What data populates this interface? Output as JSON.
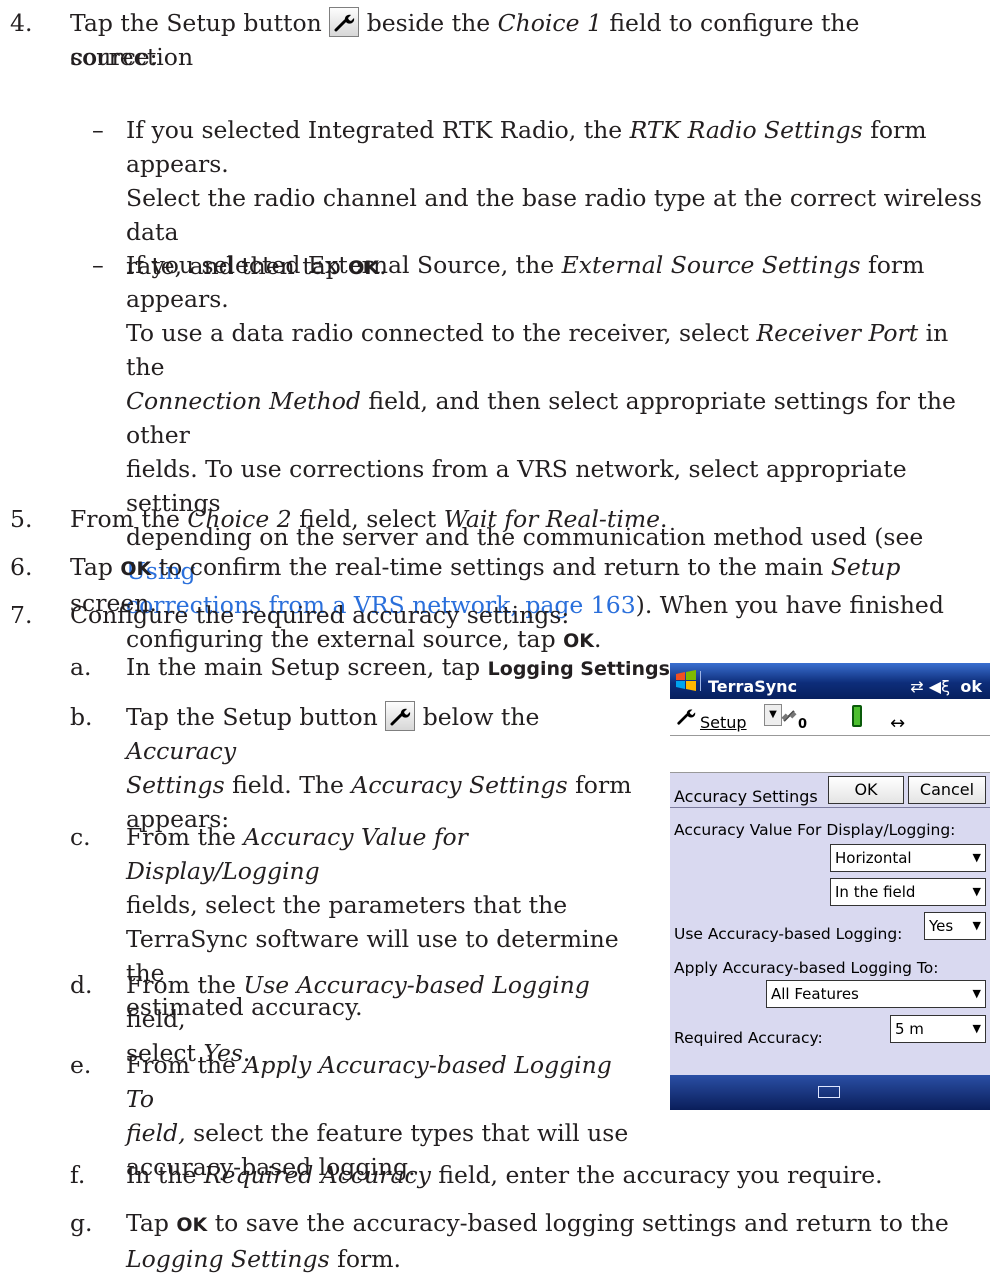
{
  "step4": {
    "num": "4.",
    "t1": "Tap the Setup button ",
    "t2": " beside the ",
    "t3": "Choice 1",
    "t4": " field to configure the correction",
    "t5": "source:"
  },
  "bullet1": {
    "dash": "–",
    "l1a": "If you selected Integrated RTK Radio, the ",
    "l1b": "RTK Radio Settings",
    "l1c": " form appears.",
    "l2": "Select the radio channel and the base radio type at the correct wireless data",
    "l3a": "rate, and then tap ",
    "l3b": "OK",
    "l3c": "."
  },
  "bullet2": {
    "dash": "–",
    "l1a": "If you selected External Source, the ",
    "l1b": "External Source Settings",
    "l1c": " form appears.",
    "l2a": "To use a data radio connected to the receiver, select ",
    "l2b": "Receiver Port",
    "l2c": " in the",
    "l3a": "Connection Method",
    "l3b": " field, and then select appropriate settings for the other",
    "l4": "fields. To use corrections from a VRS network, select appropriate settings",
    "l5a": "depending on the server and the communication method used (see ",
    "l5b": "Using",
    "l6a": "corrections from a VRS network, page 163",
    "l6b": "). When you have finished",
    "l7a": "configuring the external source, tap ",
    "l7b": "OK",
    "l7c": "."
  },
  "step5": {
    "num": "5.",
    "a": "From the ",
    "b": "Choice 2",
    "c": " field, select ",
    "d": "Wait for Real-time",
    "e": "."
  },
  "step6": {
    "num": "6.",
    "a": "Tap ",
    "b": "OK",
    "c": " to confirm the real-time settings and return to the main ",
    "d": "Setup",
    "e": " screen."
  },
  "step7": {
    "num": "7.",
    "a": "Configure the required accuracy settings:"
  },
  "sa": {
    "num": "a.",
    "a": "In the main Setup screen, tap ",
    "b": "Logging Settings",
    "c": "."
  },
  "sb": {
    "num": "b.",
    "l1a": "Tap the Setup button ",
    "l1b": " below the ",
    "l1c": "Accuracy",
    "l2a": "Settings",
    "l2b": " field. The ",
    "l2c": "Accuracy Settings",
    "l2d": " form",
    "l3": "appears:"
  },
  "sc": {
    "num": "c.",
    "l1a": "From the ",
    "l1b": "Accuracy Value for Display/Logging",
    "l2": "fields, select the parameters that the",
    "l3": "TerraSync software will use to determine the",
    "l4": "estimated accuracy."
  },
  "sd": {
    "num": "d.",
    "l1a": "From the ",
    "l1b": "Use Accuracy-based Logging",
    "l1c": " field,",
    "l2a": "select ",
    "l2b": "Yes",
    "l2c": "."
  },
  "se": {
    "num": "e.",
    "l1a": "From the ",
    "l1b": "Apply Accuracy-based Logging To",
    "l2a": "field,",
    "l2b": " select the feature types that will use",
    "l3": "accuracy-based logging."
  },
  "sf": {
    "num": "f.",
    "a": "In the ",
    "b": "Required Accuracy",
    "c": " field, enter the accuracy you require."
  },
  "sg": {
    "num": "g.",
    "l1a": "Tap ",
    "l1b": "OK",
    "l1c": " to save the accuracy-based logging settings and return to the",
    "l2a": "Logging Settings",
    "l2b": " form."
  },
  "device": {
    "app_title": "TerraSync",
    "ok": "ok",
    "tray": "⇄ ◀ξ",
    "setup_label": "Setup",
    "sat_count": "0",
    "arrow": "↔",
    "form_title": "Accuracy Settings",
    "ok_button": "OK",
    "cancel_button": "Cancel",
    "accuracy_value_label": "Accuracy Value For Display/Logging:",
    "accuracy_value_select1": "Horizontal",
    "accuracy_value_select2": "In the field",
    "use_logging_label": "Use Accuracy-based Logging:",
    "use_logging_value": "Yes",
    "apply_to_label": "Apply Accuracy-based Logging To:",
    "apply_to_value": "All Features",
    "required_accuracy_label": "Required Accuracy:",
    "required_accuracy_value": "5 m"
  }
}
